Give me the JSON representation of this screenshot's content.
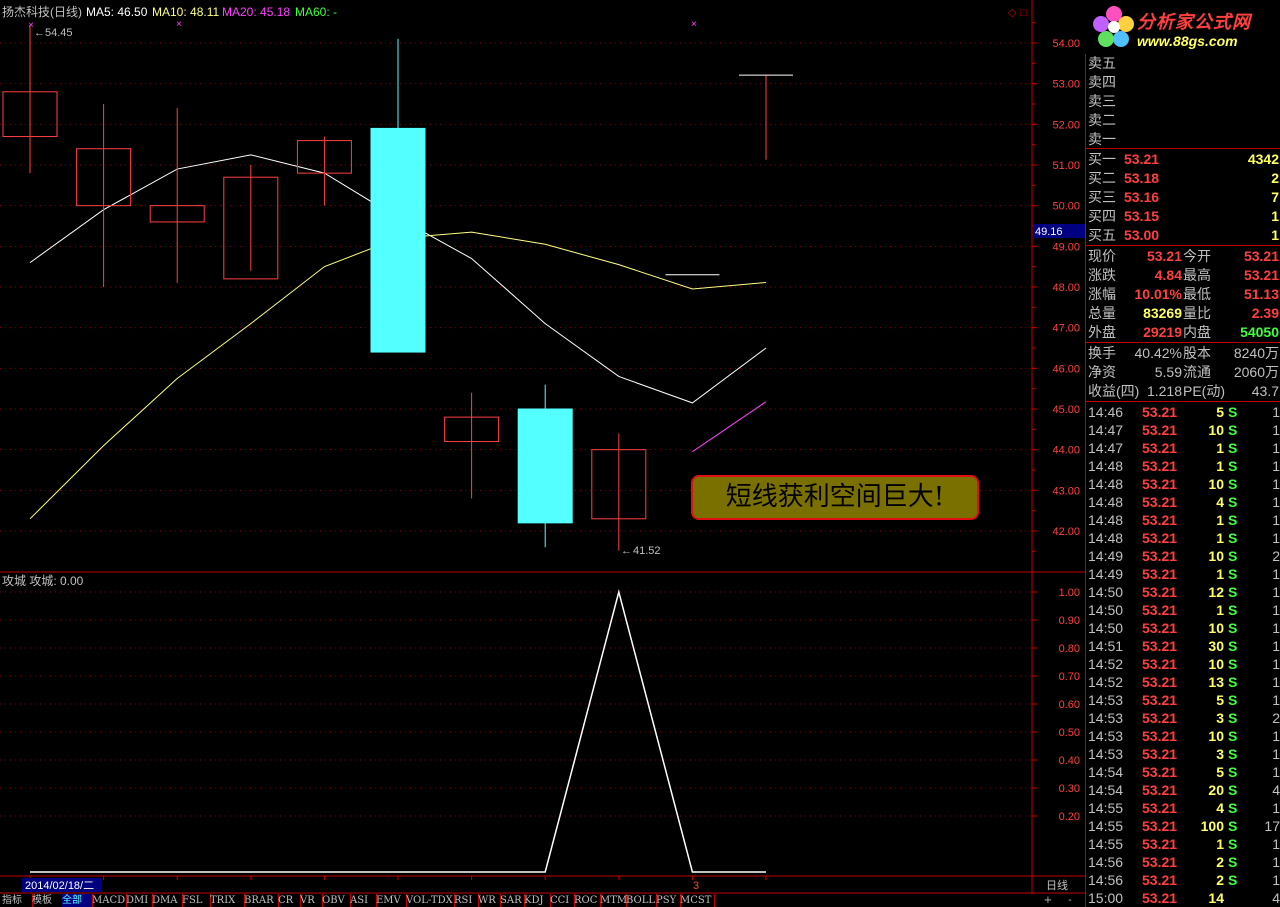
{
  "header": {
    "title": "扬杰科技(日线)",
    "ma5_label": "MA5: 46.50",
    "ma10_label": "MA10: 48.11",
    "ma20_label": "MA20: 45.18",
    "ma60_label": "MA60: -",
    "colors": {
      "ma5": "#ffffff",
      "ma10": "#ffff80",
      "ma20": "#ff40ff",
      "ma60": "#40ff40"
    }
  },
  "indicator": {
    "title": "攻城 攻城: 0.00"
  },
  "annotations": {
    "high_label": "54.45",
    "low_label": "41.52",
    "cursor_price": "49.16",
    "callout": "短线获利空间巨大!",
    "marker_3": "3"
  },
  "bottom": {
    "date": "2014/02/18/二",
    "period": "日线"
  },
  "chart_data": [
    {
      "type": "candlestick",
      "title": "扬杰科技(日线)",
      "ylim": [
        41.5,
        54.5
      ],
      "y_ticks": [
        "54.00",
        "53.00",
        "52.00",
        "51.00",
        "50.00",
        "49.00",
        "48.00",
        "47.00",
        "46.00",
        "45.00",
        "44.00",
        "43.00",
        "42.00"
      ],
      "candles": [
        {
          "open": 51.7,
          "close": 52.8,
          "high": 54.45,
          "low": 50.8
        },
        {
          "open": 50.0,
          "close": 51.4,
          "high": 52.5,
          "low": 48.0
        },
        {
          "open": 49.6,
          "close": 50.0,
          "high": 52.4,
          "low": 48.1
        },
        {
          "open": 48.2,
          "close": 50.7,
          "high": 51.0,
          "low": 48.4
        },
        {
          "open": 50.8,
          "close": 51.6,
          "high": 51.7,
          "low": 50.0
        },
        {
          "open": 51.9,
          "close": 46.4,
          "high": 54.1,
          "low": 46.4
        },
        {
          "open": 44.2,
          "close": 44.8,
          "high": 45.4,
          "low": 42.8
        },
        {
          "open": 45.0,
          "close": 42.2,
          "high": 45.6,
          "low": 41.6
        },
        {
          "open": 42.3,
          "close": 44.0,
          "high": 44.4,
          "low": 41.52
        },
        {
          "open": 48.3,
          "close": 48.3,
          "high": 48.3,
          "low": 48.3
        },
        {
          "open": 53.21,
          "close": 53.21,
          "high": 53.21,
          "low": 51.13
        }
      ],
      "series": [
        {
          "name": "MA5",
          "color": "#ffffff",
          "values": [
            48.6,
            49.9,
            50.9,
            51.25,
            50.8,
            49.7,
            48.7,
            47.1,
            45.8,
            45.15,
            46.5
          ]
        },
        {
          "name": "MA10",
          "color": "#ffff80",
          "values": [
            42.3,
            44.1,
            45.75,
            47.1,
            48.5,
            49.2,
            49.35,
            49.05,
            48.55,
            47.95,
            48.11
          ]
        },
        {
          "name": "MA20",
          "color": "#ff40ff",
          "values": [
            null,
            null,
            null,
            null,
            null,
            null,
            null,
            null,
            null,
            43.95,
            45.18
          ]
        }
      ]
    },
    {
      "type": "line",
      "title": "攻城 攻城: 0.00",
      "ylim": [
        0,
        1.05
      ],
      "y_ticks": [
        "1.00",
        "0.90",
        "0.80",
        "0.70",
        "0.60",
        "0.50",
        "0.40",
        "0.30",
        "0.20"
      ],
      "series": [
        {
          "name": "攻城",
          "color": "#ffffff",
          "values": [
            0,
            0,
            0,
            0,
            0,
            0,
            0,
            0,
            1,
            0,
            0
          ]
        }
      ]
    }
  ],
  "quote": {
    "sell": [
      {
        "label": "卖五",
        "price": "",
        "vol": ""
      },
      {
        "label": "卖四",
        "price": "",
        "vol": ""
      },
      {
        "label": "卖三",
        "price": "",
        "vol": ""
      },
      {
        "label": "卖二",
        "price": "",
        "vol": ""
      },
      {
        "label": "卖一",
        "price": "",
        "vol": ""
      }
    ],
    "buy": [
      {
        "label": "买一",
        "price": "53.21",
        "vol": "4342"
      },
      {
        "label": "买二",
        "price": "53.18",
        "vol": "2"
      },
      {
        "label": "买三",
        "price": "53.16",
        "vol": "7"
      },
      {
        "label": "买四",
        "price": "53.15",
        "vol": "1"
      },
      {
        "label": "买五",
        "price": "53.00",
        "vol": "1"
      }
    ],
    "stats": [
      {
        "l1": "现价",
        "v1": "53.21",
        "l2": "今开",
        "v2": "53.21",
        "c1": "#ff4040",
        "c2": "#ff4040"
      },
      {
        "l1": "涨跌",
        "v1": "4.84",
        "l2": "最高",
        "v2": "53.21",
        "c1": "#ff4040",
        "c2": "#ff4040"
      },
      {
        "l1": "涨幅",
        "v1": "10.01%",
        "l2": "最低",
        "v2": "51.13",
        "c1": "#ff4040",
        "c2": "#ff4040"
      },
      {
        "l1": "总量",
        "v1": "83269",
        "l2": "量比",
        "v2": "2.39",
        "c1": "#ffff60",
        "c2": "#ff4040"
      },
      {
        "l1": "外盘",
        "v1": "29219",
        "l2": "内盘",
        "v2": "54050",
        "c1": "#ff4040",
        "c2": "#40ff40"
      }
    ],
    "stats2": [
      {
        "l1": "换手",
        "v1": "40.42%",
        "l2": "股本",
        "v2": "8240万"
      },
      {
        "l1": "净资",
        "v1": "5.59",
        "l2": "流通",
        "v2": "2060万"
      },
      {
        "l1": "收益(四)",
        "v1": "1.218",
        "l2": "PE(动)",
        "v2": "43.7"
      }
    ],
    "ticks": [
      {
        "t": "14:46",
        "p": "53.21",
        "v": "5",
        "s": "S",
        "n": "1"
      },
      {
        "t": "14:47",
        "p": "53.21",
        "v": "10",
        "s": "S",
        "n": "1"
      },
      {
        "t": "14:47",
        "p": "53.21",
        "v": "1",
        "s": "S",
        "n": "1"
      },
      {
        "t": "14:48",
        "p": "53.21",
        "v": "1",
        "s": "S",
        "n": "1"
      },
      {
        "t": "14:48",
        "p": "53.21",
        "v": "10",
        "s": "S",
        "n": "1"
      },
      {
        "t": "14:48",
        "p": "53.21",
        "v": "4",
        "s": "S",
        "n": "1"
      },
      {
        "t": "14:48",
        "p": "53.21",
        "v": "1",
        "s": "S",
        "n": "1"
      },
      {
        "t": "14:48",
        "p": "53.21",
        "v": "1",
        "s": "S",
        "n": "1"
      },
      {
        "t": "14:49",
        "p": "53.21",
        "v": "10",
        "s": "S",
        "n": "2"
      },
      {
        "t": "14:49",
        "p": "53.21",
        "v": "1",
        "s": "S",
        "n": "1"
      },
      {
        "t": "14:50",
        "p": "53.21",
        "v": "12",
        "s": "S",
        "n": "1"
      },
      {
        "t": "14:50",
        "p": "53.21",
        "v": "1",
        "s": "S",
        "n": "1"
      },
      {
        "t": "14:50",
        "p": "53.21",
        "v": "10",
        "s": "S",
        "n": "1"
      },
      {
        "t": "14:51",
        "p": "53.21",
        "v": "30",
        "s": "S",
        "n": "1"
      },
      {
        "t": "14:52",
        "p": "53.21",
        "v": "10",
        "s": "S",
        "n": "1"
      },
      {
        "t": "14:52",
        "p": "53.21",
        "v": "13",
        "s": "S",
        "n": "1"
      },
      {
        "t": "14:53",
        "p": "53.21",
        "v": "5",
        "s": "S",
        "n": "1"
      },
      {
        "t": "14:53",
        "p": "53.21",
        "v": "3",
        "s": "S",
        "n": "2"
      },
      {
        "t": "14:53",
        "p": "53.21",
        "v": "10",
        "s": "S",
        "n": "1"
      },
      {
        "t": "14:53",
        "p": "53.21",
        "v": "3",
        "s": "S",
        "n": "1"
      },
      {
        "t": "14:54",
        "p": "53.21",
        "v": "5",
        "s": "S",
        "n": "1"
      },
      {
        "t": "14:54",
        "p": "53.21",
        "v": "20",
        "s": "S",
        "n": "4"
      },
      {
        "t": "14:55",
        "p": "53.21",
        "v": "4",
        "s": "S",
        "n": "1"
      },
      {
        "t": "14:55",
        "p": "53.21",
        "v": "100",
        "s": "S",
        "n": "17"
      },
      {
        "t": "14:55",
        "p": "53.21",
        "v": "1",
        "s": "S",
        "n": "1"
      },
      {
        "t": "14:56",
        "p": "53.21",
        "v": "2",
        "s": "S",
        "n": "1"
      },
      {
        "t": "14:56",
        "p": "53.21",
        "v": "2",
        "s": "S",
        "n": "1"
      },
      {
        "t": "15:00",
        "p": "53.21",
        "v": "14",
        "s": "",
        "n": "4"
      }
    ]
  },
  "logo": {
    "title": "分析家公式网",
    "url": "www.88gs.com"
  },
  "tabs": [
    "指标",
    "模板",
    "全部",
    "MACD",
    "DMI",
    "DMA",
    "FSL",
    "TRIX",
    "BRAR",
    "CR",
    "VR",
    "OBV",
    "ASI",
    "EMV",
    "VOL-TDX",
    "RSI",
    "WR",
    "SAR",
    "KDJ",
    "CCI",
    "ROC",
    "MTM",
    "BOLL",
    "PSY",
    "MCST"
  ],
  "tab_buttons": [
    "+",
    "-"
  ]
}
